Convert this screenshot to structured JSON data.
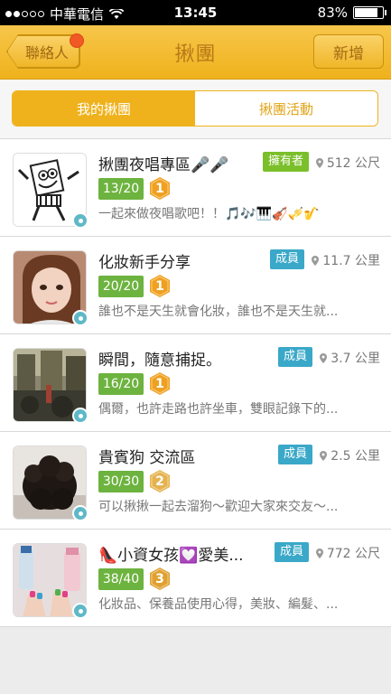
{
  "status_bar": {
    "carrier": "中華電信",
    "time": "13:45",
    "battery": "83%",
    "battery_level": 0.83
  },
  "nav": {
    "back_label": "聯絡人",
    "title": "揪團",
    "add_label": "新增"
  },
  "tabs": {
    "mine": "我的揪團",
    "events": "揪團活動"
  },
  "groups": [
    {
      "name": "揪團夜唱專區🎤🎤",
      "role": "擁有者",
      "role_type": "owner",
      "distance": "512 公尺",
      "count": "13/20",
      "level": "1",
      "level_color": "#f0a020",
      "description": "一起來做夜唱歌吧！！🎵🎶🎹🎻🎺🎷",
      "thumb_color": "#ffffff",
      "thumb_icon": "spongebob-thumbnail"
    },
    {
      "name": "化妝新手分享",
      "role": "成員",
      "role_type": "member",
      "distance": "11.7 公里",
      "count": "20/20",
      "level": "1",
      "level_color": "#f0a020",
      "description": "誰也不是天生就會化妝，誰也不是天生就...",
      "thumb_color": "#c9a08a",
      "thumb_icon": "girl-portrait-thumbnail"
    },
    {
      "name": "瞬間，隨意捕捉。",
      "role": "成員",
      "role_type": "member",
      "distance": "3.7 公里",
      "count": "16/20",
      "level": "1",
      "level_color": "#f0a020",
      "description": "偶爾，也許走路也許坐車，雙眼記錄下的...",
      "thumb_color": "#6d6a4a",
      "thumb_icon": "street-scene-thumbnail"
    },
    {
      "name": "貴賓狗 交流區",
      "role": "成員",
      "role_type": "member",
      "distance": "2.5 公里",
      "count": "30/30",
      "level": "2",
      "level_color": "#e5b24e",
      "description": "可以揪揪一起去溜狗～歡迎大家來交友～...",
      "thumb_color": "#2a2320",
      "thumb_icon": "poodle-thumbnail"
    },
    {
      "name": "👠小資女孩💟愛美...",
      "role": "成員",
      "role_type": "member",
      "distance": "772 公尺",
      "count": "38/40",
      "level": "3",
      "level_color": "#e0a030",
      "description": "化妝品、保養品使用心得，美妝、編髮、...",
      "thumb_color": "#d8c8c8",
      "thumb_icon": "nail-art-thumbnail"
    }
  ]
}
